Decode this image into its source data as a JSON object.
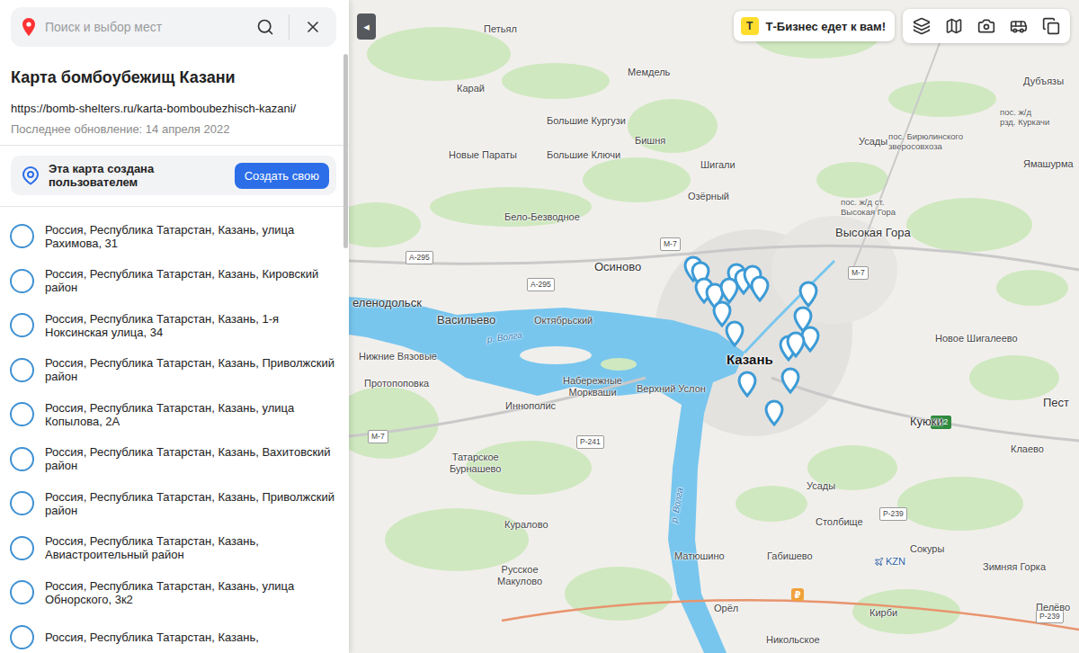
{
  "search": {
    "placeholder": "Поиск и выбор мест"
  },
  "collapse_button": "◂",
  "map_info": {
    "title": "Карта бомбоубежищ Казани",
    "url": "https://bomb-shelters.ru/karta-bomboubezhisch-kazani/",
    "updated": "Последнее обновление: 14 апреля 2022"
  },
  "user_map_note": {
    "text": "Эта карта создана пользователем",
    "button": "Создать свою"
  },
  "list": [
    {
      "address": "Россия, Республика Татарстан, Казань, улица Рахимова, 31"
    },
    {
      "address": "Россия, Республика Татарстан, Казань, Кировский район"
    },
    {
      "address": "Россия, Республика Татарстан, Казань, 1-я Ноксинская улица, 34"
    },
    {
      "address": "Россия, Республика Татарстан, Казань, Приволжский район"
    },
    {
      "address": "Россия, Республика Татарстан, Казань, улица Копылова, 2А"
    },
    {
      "address": "Россия, Республика Татарстан, Казань, Вахитовский район"
    },
    {
      "address": "Россия, Республика Татарстан, Казань, Приволжский район"
    },
    {
      "address": "Россия, Республика Татарстан, Казань, Авиастроительный район"
    },
    {
      "address": "Россия, Республика Татарстан, Казань, улица Обнорского, 3к2"
    },
    {
      "address": "Россия, Республика Татарстан, Казань,"
    }
  ],
  "promo": {
    "logo": "Т",
    "text": "Т-Бизнес едет к вам!"
  },
  "map": {
    "labels": [
      {
        "text": "Петьял",
        "kind": "village"
      },
      {
        "text": "Мемдель",
        "kind": "village"
      },
      {
        "text": "Карай",
        "kind": "village"
      },
      {
        "text": "Дубъязы",
        "kind": "village"
      },
      {
        "text": "Большие Кургузи",
        "kind": "village"
      },
      {
        "text": "Бишня",
        "kind": "village"
      },
      {
        "text": "Новые Параты",
        "kind": "village"
      },
      {
        "text": "Большие Ключи",
        "kind": "village"
      },
      {
        "text": "Шигали",
        "kind": "village"
      },
      {
        "text": "Усады",
        "kind": "village"
      },
      {
        "text": "пос. ж/д\nрзд. Куркачи",
        "kind": "station"
      },
      {
        "text": "пос. Бирюлинского\nзверосовхоза",
        "kind": "station"
      },
      {
        "text": "Ямашурма",
        "kind": "village"
      },
      {
        "text": "Озёрный",
        "kind": "village"
      },
      {
        "text": "пос. ж/д ст.\nВысокая Гора",
        "kind": "station"
      },
      {
        "text": "Высокая Гора",
        "kind": "town"
      },
      {
        "text": "Бело-Безводное",
        "kind": "village"
      },
      {
        "text": "Осиново",
        "kind": "town"
      },
      {
        "text": "еленодольск",
        "kind": "town"
      },
      {
        "text": "Васильево",
        "kind": "town"
      },
      {
        "text": "Октябрьский",
        "kind": "village"
      },
      {
        "text": "Нижние Вязовые",
        "kind": "village"
      },
      {
        "text": "Протопоповка",
        "kind": "village"
      },
      {
        "text": "Набережные\nМоркваши",
        "kind": "village"
      },
      {
        "text": "Верхний Услон",
        "kind": "village"
      },
      {
        "text": "Иннополис",
        "kind": "village"
      },
      {
        "text": "Казань",
        "kind": "city"
      },
      {
        "text": "Новое Шигалеево",
        "kind": "village"
      },
      {
        "text": "Пест",
        "kind": "town"
      },
      {
        "text": "Куюки",
        "kind": "town"
      },
      {
        "text": "Клаево",
        "kind": "village"
      },
      {
        "text": "Усады",
        "kind": "village"
      },
      {
        "text": "Столбище",
        "kind": "village"
      },
      {
        "text": "Татарское\nБурнашево",
        "kind": "village"
      },
      {
        "text": "Куралово",
        "kind": "village"
      },
      {
        "text": "Русское\nМакулово",
        "kind": "village"
      },
      {
        "text": "Матюшино",
        "kind": "village"
      },
      {
        "text": "Габишево",
        "kind": "village"
      },
      {
        "text": "Сокуры",
        "kind": "village"
      },
      {
        "text": "Зимняя Горка",
        "kind": "village"
      },
      {
        "text": "KZN",
        "kind": "airport"
      },
      {
        "text": "Орёл",
        "kind": "village"
      },
      {
        "text": "Кирби",
        "kind": "village"
      },
      {
        "text": "Пелёво",
        "kind": "village"
      },
      {
        "text": "Никольское",
        "kind": "village"
      },
      {
        "text": "р. Волга",
        "kind": "water"
      },
      {
        "text": "р. Волга",
        "kind": "water"
      }
    ],
    "road_signs": [
      {
        "text": "М-7",
        "kind": "federal"
      },
      {
        "text": "А-295",
        "kind": "federal"
      },
      {
        "text": "А-295",
        "kind": "federal"
      },
      {
        "text": "М-7",
        "kind": "federal"
      },
      {
        "text": "М-7",
        "kind": "federal"
      },
      {
        "text": "Р-241",
        "kind": "federal"
      },
      {
        "text": "E22",
        "kind": "european"
      },
      {
        "text": "Р-239",
        "kind": "federal"
      },
      {
        "text": "Р-239",
        "kind": "federal"
      }
    ],
    "payment_marker": "₽"
  }
}
